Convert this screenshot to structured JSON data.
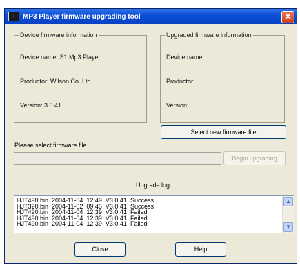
{
  "window": {
    "title": "MP3 Player firmware upgrading tool",
    "app_icon": "app-icon",
    "close_glyph": "✕"
  },
  "device_info": {
    "legend": "Device firmware information",
    "name": "Device name: S1 Mp3 Player",
    "producer": "Productor: Wilson Co. Ltd.",
    "version": "Version: 3.0.41"
  },
  "upgraded_info": {
    "legend": "Upgraded firmware information",
    "name": "Device name:",
    "producer": "Productor:",
    "version": "Version:"
  },
  "buttons": {
    "select_firmware": "Select new firmware file",
    "begin_upgrading": "Begin upgrading",
    "close": "Close",
    "help": "Help"
  },
  "firmware_select": {
    "label": "Please select firmware file",
    "value": ""
  },
  "upgrade_log": {
    "title": "Upgrade log",
    "entries": [
      "HJT490.bin  2004-11-04  12:49  V3.0.41  Success",
      "HJT320.bin  2004-11-02  09:45  V3.0.41  Success",
      "HJT490.bin  2004-11-04  12:39  V3.0.41  Failed",
      "HJT490.bin  2004-11-04  12:39  V3.0.41  Failed",
      "HJT490.bin  2004-11-04  12:39  V3.0.41  Failed"
    ]
  }
}
